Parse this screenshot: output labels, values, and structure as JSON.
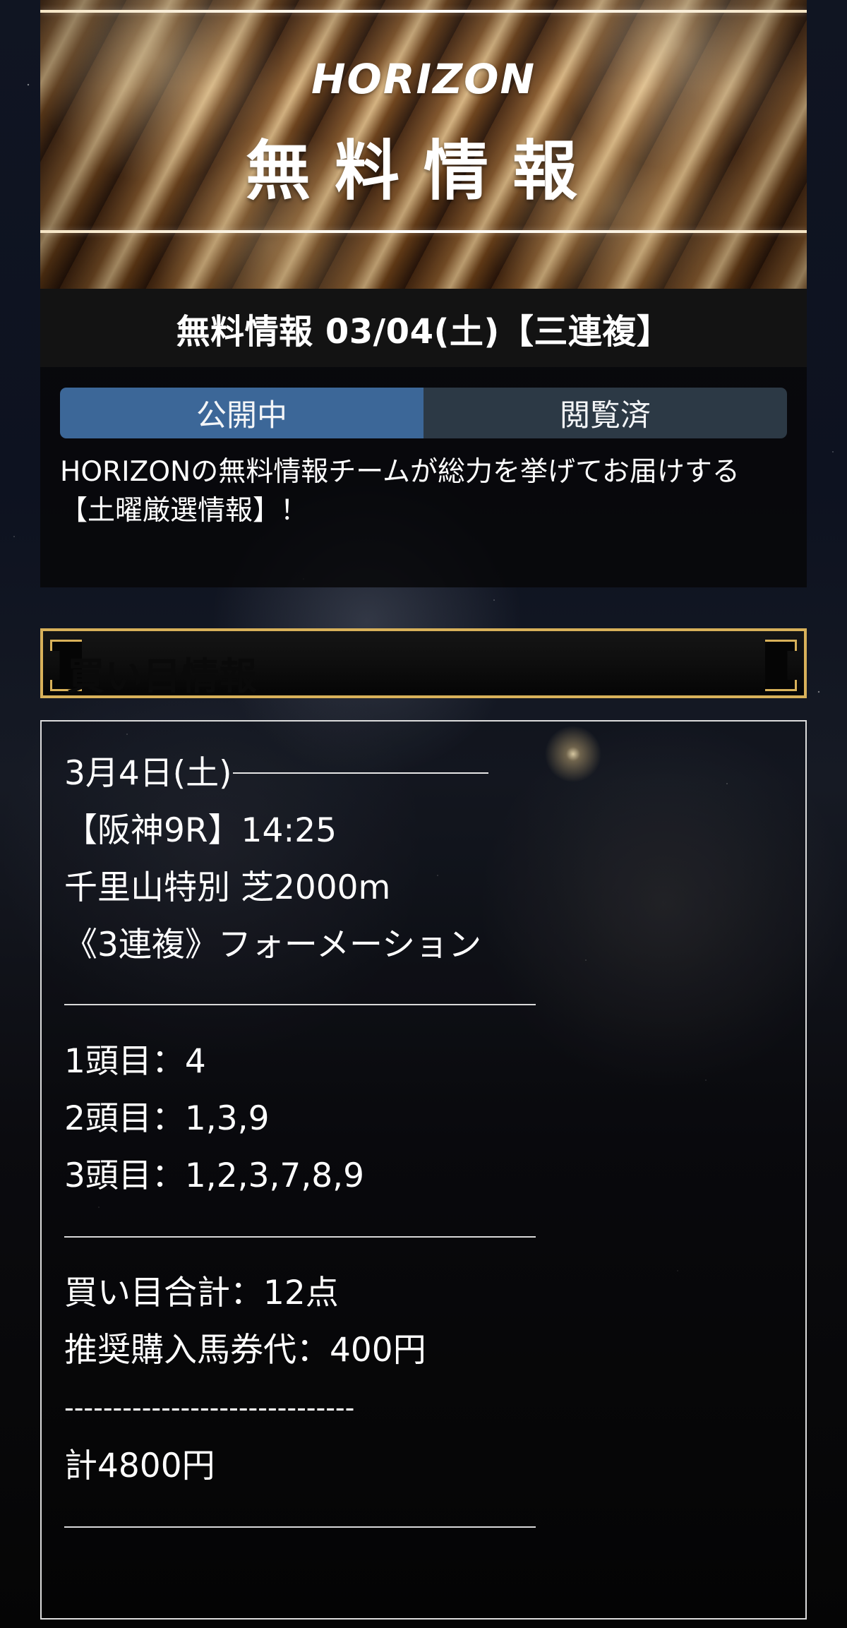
{
  "hero": {
    "brand": "HORIZON",
    "title": "無料情報"
  },
  "info": {
    "header_title": "無料情報 03/04(土)【三連複】",
    "tabs": [
      {
        "label": "公開中",
        "active": true
      },
      {
        "label": "閲覧済",
        "active": false
      }
    ],
    "description": "HORIZONの無料情報チームが総力を挙げてお届けする\n【土曜厳選情報】！"
  },
  "picks": {
    "section_title": "買い目情報",
    "date_label": "3月4日(土)",
    "race_info": "【阪神9R】14:25",
    "race_name": "千里山特別 芝2000m",
    "bet_type": "《3連複》フォーメーション",
    "selections": [
      "1頭目：4",
      "2頭目：1,3,9",
      "3頭目：1,2,3,7,8,9"
    ],
    "total_points": "買い目合計：12点",
    "recommended_amount": "推奨購入馬券代：400円",
    "dashed_separator": "------------------------------",
    "grand_total": "計4800円"
  },
  "colors": {
    "tab_active": "#3c6798",
    "tab_inactive": "#2c3945",
    "accent_gold": "#d8b15a",
    "menu_green": "#5fd447"
  }
}
